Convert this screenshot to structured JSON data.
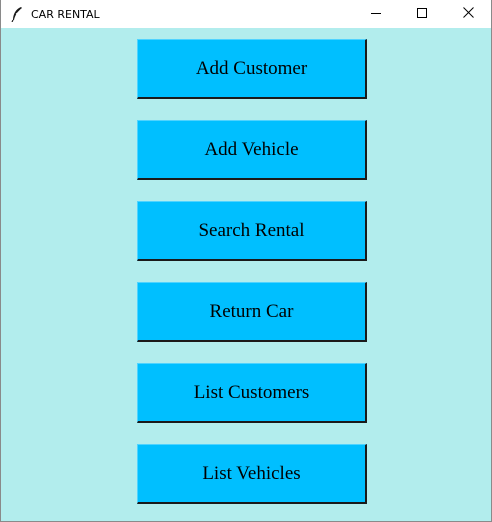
{
  "window": {
    "title": "CAR RENTAL",
    "icon": "feather-icon",
    "controls": [
      "minimize-icon",
      "maximize-icon",
      "close-icon"
    ]
  },
  "menu": {
    "buttons": [
      {
        "label": "Add Customer"
      },
      {
        "label": "Add Vehicle"
      },
      {
        "label": "Search Rental"
      },
      {
        "label": "Return Car"
      },
      {
        "label": "List Customers"
      },
      {
        "label": "List Vehicles"
      }
    ]
  },
  "colors": {
    "background": "#b2eded",
    "button": "#00bfff",
    "titlebar": "#ffffff"
  }
}
